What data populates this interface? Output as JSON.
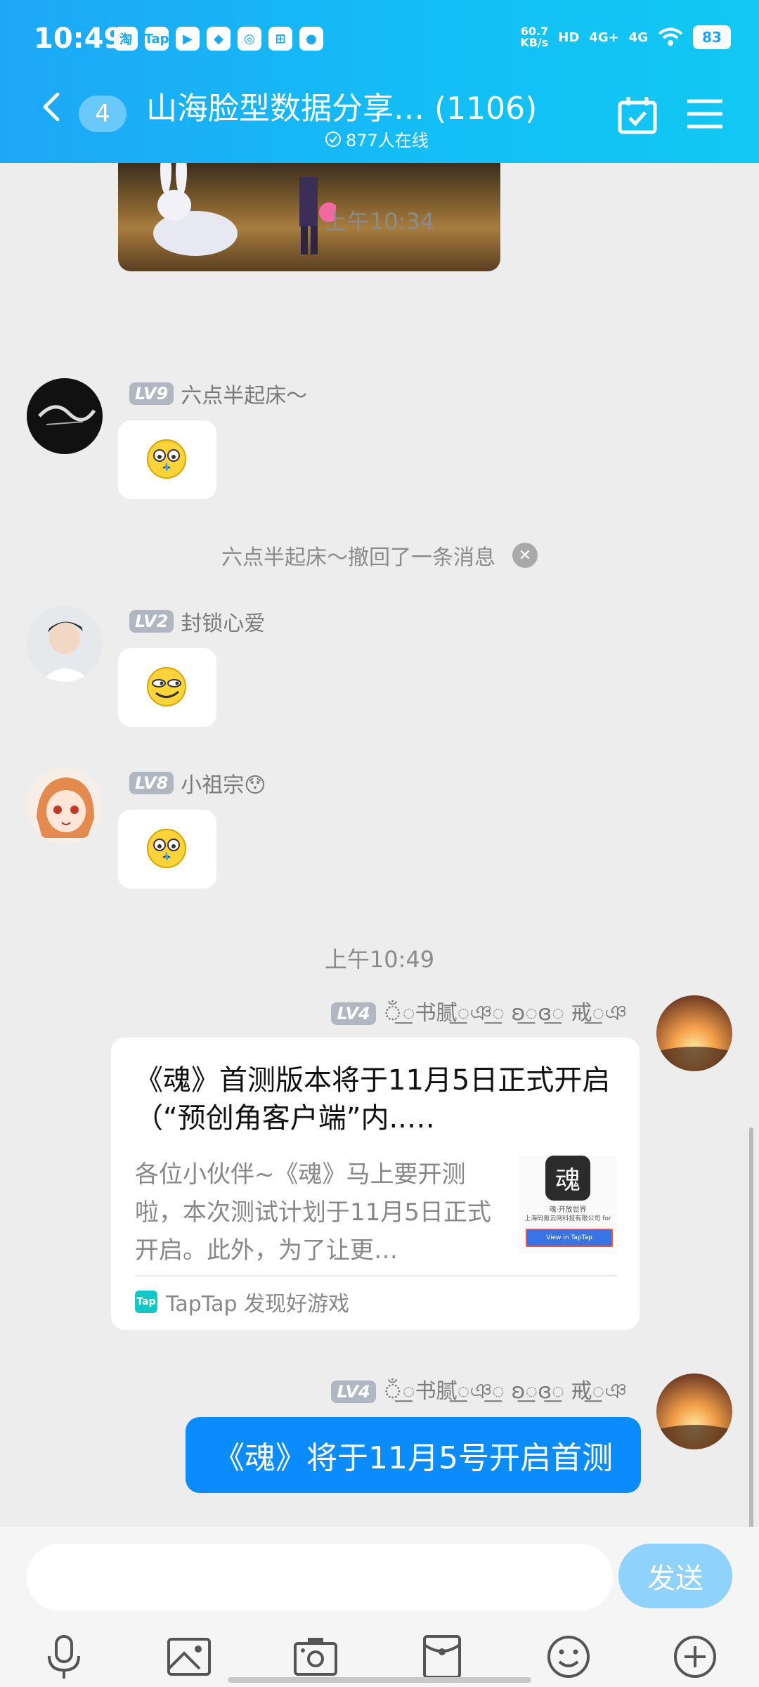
{
  "status_bar": {
    "time": "10:49",
    "net_speed_value": "60.7",
    "net_speed_unit": "KB/s",
    "hd_label": "HD",
    "signal_1": "4G+",
    "signal_2": "4G",
    "battery": "83",
    "app_icons": [
      "淘",
      "Tap",
      "▶",
      "◆",
      "◎",
      "⊞",
      "●"
    ]
  },
  "header": {
    "unread_count": "4",
    "title": "山海脸型数据分享… (1106)",
    "online": "877人在线"
  },
  "messages": [
    {
      "type": "time",
      "text": "上午10:34"
    },
    {
      "type": "emoji",
      "level": "LV9",
      "nickname": "六点半起床～",
      "avatar_color": "#141414",
      "emoji": "cry-face-icon"
    },
    {
      "type": "recall",
      "text": "六点半起床～撤回了一条消息"
    },
    {
      "type": "emoji",
      "level": "LV2",
      "nickname": "封锁心爱",
      "emoji": "smirk-face-icon"
    },
    {
      "type": "emoji",
      "level": "LV8",
      "nickname": "小祖宗😯",
      "emoji": "cry-face-icon"
    },
    {
      "type": "time",
      "text": "上午10:49"
    }
  ],
  "time_1": "上午10:34",
  "time_2": "上午10:49",
  "msg1": {
    "level": "LV9",
    "nickname": "六点半起床～"
  },
  "recall_text": "六点半起床～撤回了一条消息",
  "msg2": {
    "level": "LV2",
    "nickname": "封锁心爱"
  },
  "msg3": {
    "level": "LV8",
    "nickname": "小祖宗😯"
  },
  "msg4": {
    "level": "LV4",
    "nickname": "ঁ꯭书腻꯭ঞ꯭ ʚ꯭ɞ꯭ 戒꯭ঞ",
    "card": {
      "title": "《魂》首测版本将于11月5日正式开启（“预创角客户端”内..…",
      "description": "各位小伙伴~《魂》马上要开测啦，本次测试计划于11月5日正式开启。此外，为了让更…",
      "source": "TapTap 发现好游戏",
      "source_icon": "Tap",
      "thumb_caption_1": "魂·开放世界",
      "thumb_caption_2": "上海码氪云网科技有限公司 for",
      "thumb_button": "View in TapTap",
      "thumb_logo": "魂"
    }
  },
  "msg5": {
    "level": "LV4",
    "nickname": "ঁ꯭书腻꯭ঞ꯭ ʚ꯭ɞ꯭ 戒꯭ঞ",
    "text": "《魂》将于11月5号开启首测"
  },
  "input": {
    "placeholder": "",
    "send_label": "发送"
  },
  "toolbar": [
    "microphone-icon",
    "picture-icon",
    "camera-icon",
    "red-packet-icon",
    "emoji-icon",
    "plus-icon"
  ],
  "colors": {
    "header_accent": "#1ea7f7",
    "my_bubble": "#0a8cff",
    "send_button": "#8fd2fb",
    "level_badge": "#b1b6c3"
  }
}
